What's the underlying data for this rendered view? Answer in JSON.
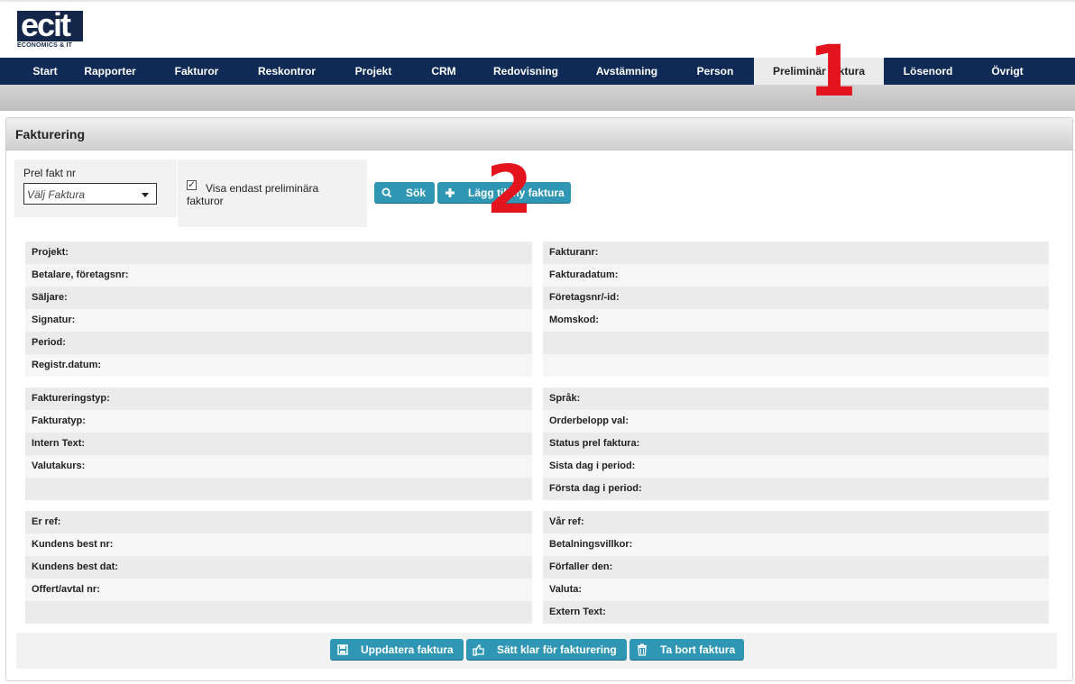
{
  "logo": {
    "text": "ecit",
    "subtitle": "ECONOMICS & IT"
  },
  "nav": {
    "items": [
      {
        "label": "Start"
      },
      {
        "label": "Rapporter"
      },
      {
        "label": "Fakturor"
      },
      {
        "label": "Reskontror"
      },
      {
        "label": "Projekt"
      },
      {
        "label": "CRM"
      },
      {
        "label": "Redovisning"
      },
      {
        "label": "Avstämning"
      },
      {
        "label": "Person"
      },
      {
        "label": "Preliminär faktura",
        "active": true
      },
      {
        "label": "Lösenord"
      },
      {
        "label": "Övrigt"
      }
    ]
  },
  "annotations": {
    "one": "1",
    "two": "2"
  },
  "panel": {
    "title": "Fakturering"
  },
  "filter": {
    "prel_label": "Prel fakt nr",
    "select_value": "Välj Faktura",
    "checkbox_checked": true,
    "checkbox_mark": "✓",
    "checkbox_label": "Visa endast preliminära fakturor"
  },
  "buttons": {
    "search": "Sök",
    "add": "Lägg till ny faktura",
    "update": "Uppdatera faktura",
    "ready": "Sätt klar för fakturering",
    "delete": "Ta bort faktura"
  },
  "sections": {
    "left1": [
      "Projekt:",
      "Betalare, företagsnr:",
      "Säljare:",
      "Signatur:",
      "Period:",
      "Registr.datum:"
    ],
    "right1": [
      "Fakturanr:",
      "Fakturadatum:",
      "Företagsnr/-id:",
      "Momskod:",
      "",
      ""
    ],
    "left2": [
      "Faktureringstyp:",
      "Fakturatyp:",
      "Intern Text:",
      "Valutakurs:",
      ""
    ],
    "right2": [
      "Språk:",
      "Orderbelopp val:",
      "Status prel faktura:",
      "Sista dag i period:",
      "Första dag i period:"
    ],
    "left3": [
      "Er ref:",
      "Kundens best nr:",
      "Kundens best dat:",
      "Offert/avtal nr:",
      ""
    ],
    "right3": [
      "Vår ref:",
      "Betalningsvillkor:",
      "Förfaller den:",
      "Valuta:",
      "Extern Text:"
    ]
  },
  "colors": {
    "nav_bg": "#0e2a55",
    "button": "#2f96b4",
    "annotation": "#e3141e"
  }
}
